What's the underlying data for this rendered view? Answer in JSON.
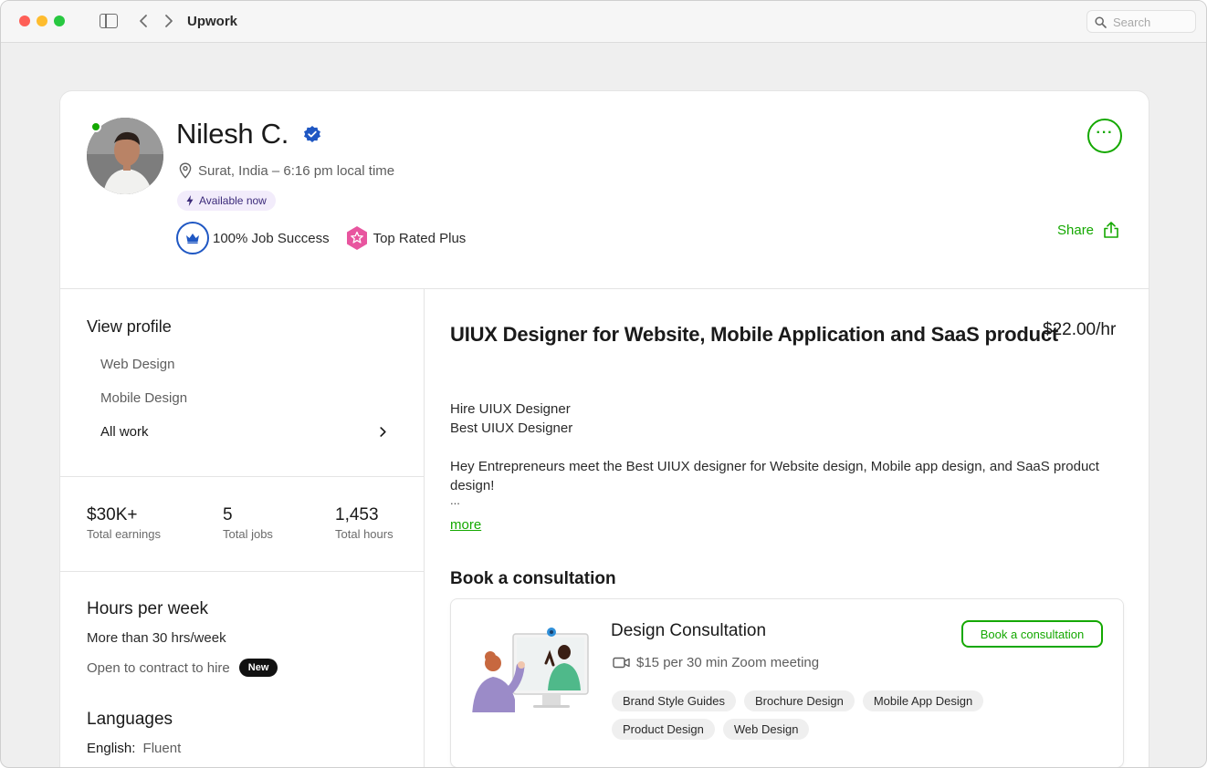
{
  "window": {
    "title": "Upwork",
    "search_placeholder": "Search"
  },
  "profile": {
    "name": "Nilesh C.",
    "location": "Surat, India – 6:16 pm local time",
    "availability": "Available now",
    "badges": [
      {
        "label": "100% Job Success",
        "icon": "crown-icon"
      },
      {
        "label": "Top Rated Plus",
        "icon": "star-badge-icon"
      }
    ],
    "share_label": "Share",
    "more_label": "···"
  },
  "view_profile": {
    "title": "View profile",
    "items": [
      "Web Design",
      "Mobile Design",
      "All work"
    ]
  },
  "stats": [
    {
      "value": "$30K+",
      "label": "Total earnings"
    },
    {
      "value": "5",
      "label": "Total jobs"
    },
    {
      "value": "1,453",
      "label": "Total hours"
    }
  ],
  "hours": {
    "title": "Hours per week",
    "value": "More than 30 hrs/week",
    "contract": "Open to contract to hire",
    "new_badge": "New"
  },
  "languages": {
    "title": "Languages",
    "entries": [
      {
        "name": "English:",
        "level": "Fluent"
      }
    ]
  },
  "job": {
    "title": "UIUX Designer for Website, Mobile Application and SaaS product",
    "rate": "$22.00/hr",
    "bio_lines": [
      "Hire UIUX Designer",
      "Best UIUX Designer"
    ],
    "bio_paragraph": "Hey Entrepreneurs meet the Best UIUX designer for Website design, Mobile app design, and SaaS product design!",
    "bio_ellipsis": "...",
    "more_link": "more"
  },
  "consultation": {
    "section_title": "Book a consultation",
    "card_title": "Design Consultation",
    "price": "$15 per 30 min Zoom meeting",
    "button_label": "Book a consultation",
    "tags": [
      "Brand Style Guides",
      "Brochure Design",
      "Mobile App Design",
      "Product Design",
      "Web Design"
    ]
  },
  "colors": {
    "accent": "#14a800",
    "verified": "#1f57c3",
    "top_rated": "#e8559f"
  }
}
